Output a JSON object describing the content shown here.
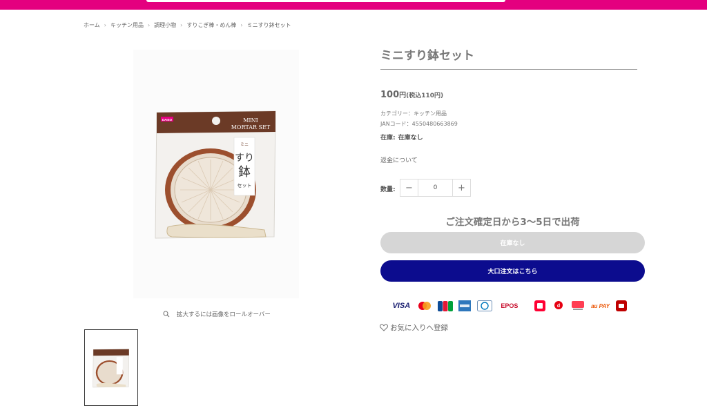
{
  "breadcrumb": {
    "items": [
      "ホーム",
      "キッチン用品",
      "調理小物",
      "すりこぎ棒・めん棒",
      "ミニすり鉢セット"
    ],
    "separator": "›"
  },
  "product": {
    "title": "ミニすり鉢セット",
    "price_amount": "100",
    "price_yen": "円",
    "price_tax": "(税込110円)",
    "category": "カテゴリー：キッチン用品",
    "jan": "JANコード：4550480663869",
    "stock_label": "在庫:",
    "stock_value": "在庫なし",
    "refund_link": "返金について",
    "quantity_label": "数量:",
    "quantity_value": "0",
    "quantity_minus": "−",
    "quantity_plus": "+",
    "shipping_note": "ご注文確定日から3〜5日で出荷",
    "soldout_button": "在庫なし",
    "bulk_button": "大口注文はこちら",
    "favorite": "お気に入りへ登録"
  },
  "gallery": {
    "zoom_hint": "拡大するには画像をロールオーバー",
    "package_brand": "DAISO",
    "package_line1": "MINI",
    "package_line2": "MORTAR SET",
    "package_jp_small": "ミニ",
    "package_jp_big1": "すり",
    "package_jp_big2": "鉢",
    "package_jp_set": "セット"
  },
  "payments": {
    "methods": [
      "VISA",
      "Mastercard",
      "JCB",
      "AMEX",
      "Diners Club",
      "EPOS",
      "PayPay",
      "d払い",
      "メルペイ",
      "au PAY",
      "楽天ペイ"
    ],
    "visa_text": "VISA",
    "epos_text": "EPOS",
    "aupay_text": "au PAY"
  },
  "colors": {
    "brand_pink": "#e4007f",
    "bulk_button": "#0c0c8e",
    "soldout_button": "#d6d6d6",
    "package_brown": "#6b3a26"
  }
}
